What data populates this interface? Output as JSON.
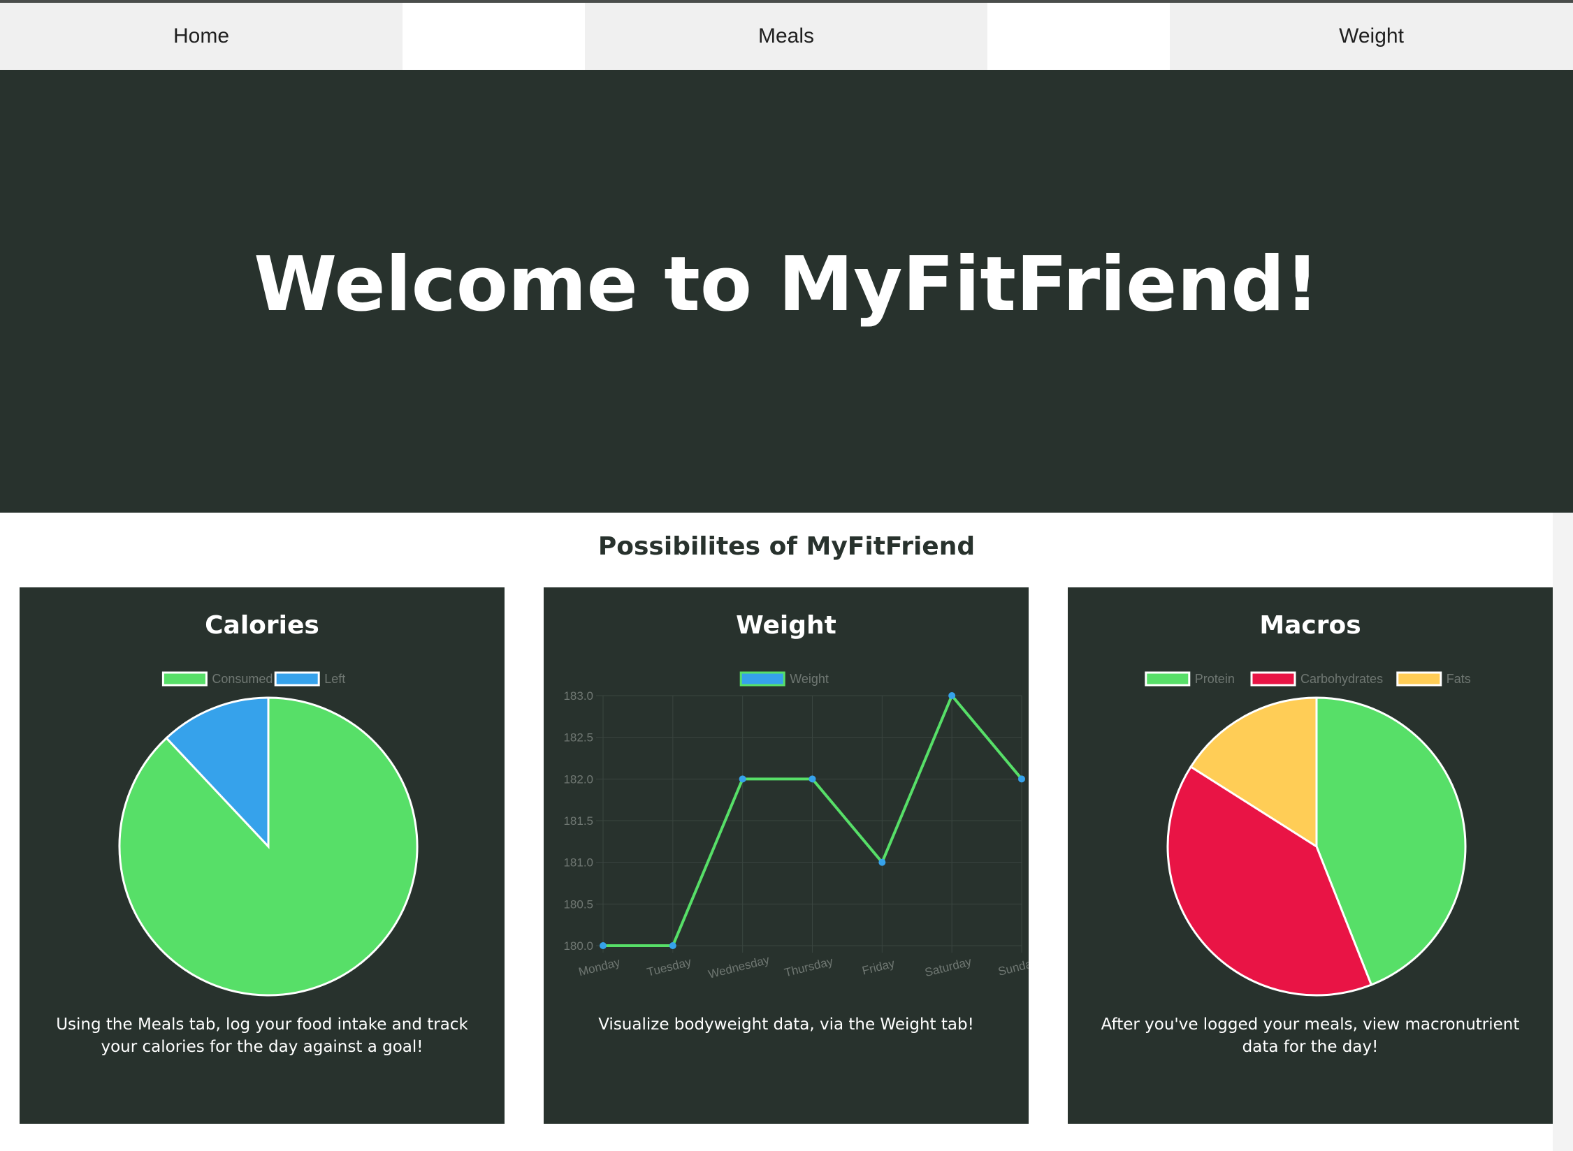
{
  "nav": {
    "home": "Home",
    "meals": "Meals",
    "weight": "Weight"
  },
  "hero": {
    "title": "Welcome to MyFitFriend!"
  },
  "section": {
    "title": "Possibilites of MyFitFriend"
  },
  "colors": {
    "dark_bg": "#28322d",
    "green": "#57df68",
    "blue": "#36a2eb",
    "red": "#e91445",
    "yellow": "#ffcd56"
  },
  "cards": {
    "calories": {
      "title": "Calories",
      "description": "Using the Meals tab, log your food intake and track your calories for the day against a goal!"
    },
    "weight": {
      "title": "Weight",
      "description": "Visualize bodyweight data, via the Weight tab!"
    },
    "macros": {
      "title": "Macros",
      "description": "After you've logged your meals, view macronutrient data for the day!"
    }
  },
  "chart_data": [
    {
      "type": "pie",
      "categories": [
        "Consumed",
        "Left"
      ],
      "values": [
        88,
        12
      ],
      "colors": [
        "#57df68",
        "#36a2eb"
      ],
      "legend": "top"
    },
    {
      "type": "line",
      "categories": [
        "Monday",
        "Tuesday",
        "Wednesday",
        "Thursday",
        "Friday",
        "Saturday",
        "Sunday"
      ],
      "series": [
        {
          "name": "Weight",
          "values": [
            180.0,
            180.0,
            182.0,
            182.0,
            181.0,
            183.0,
            182.0
          ]
        }
      ],
      "ylim": [
        180.0,
        183.0
      ],
      "yticks": [
        "183.0",
        "182.5",
        "182.0",
        "181.5",
        "181.0",
        "180.5",
        "180.0"
      ],
      "line_color": "#57df68",
      "point_color": "#36a2eb",
      "grid": true,
      "legend": "top"
    },
    {
      "type": "pie",
      "categories": [
        "Protein",
        "Carbohydrates",
        "Fats"
      ],
      "values": [
        44,
        40,
        16
      ],
      "colors": [
        "#57df68",
        "#e91445",
        "#ffcd56"
      ],
      "legend": "top"
    }
  ]
}
